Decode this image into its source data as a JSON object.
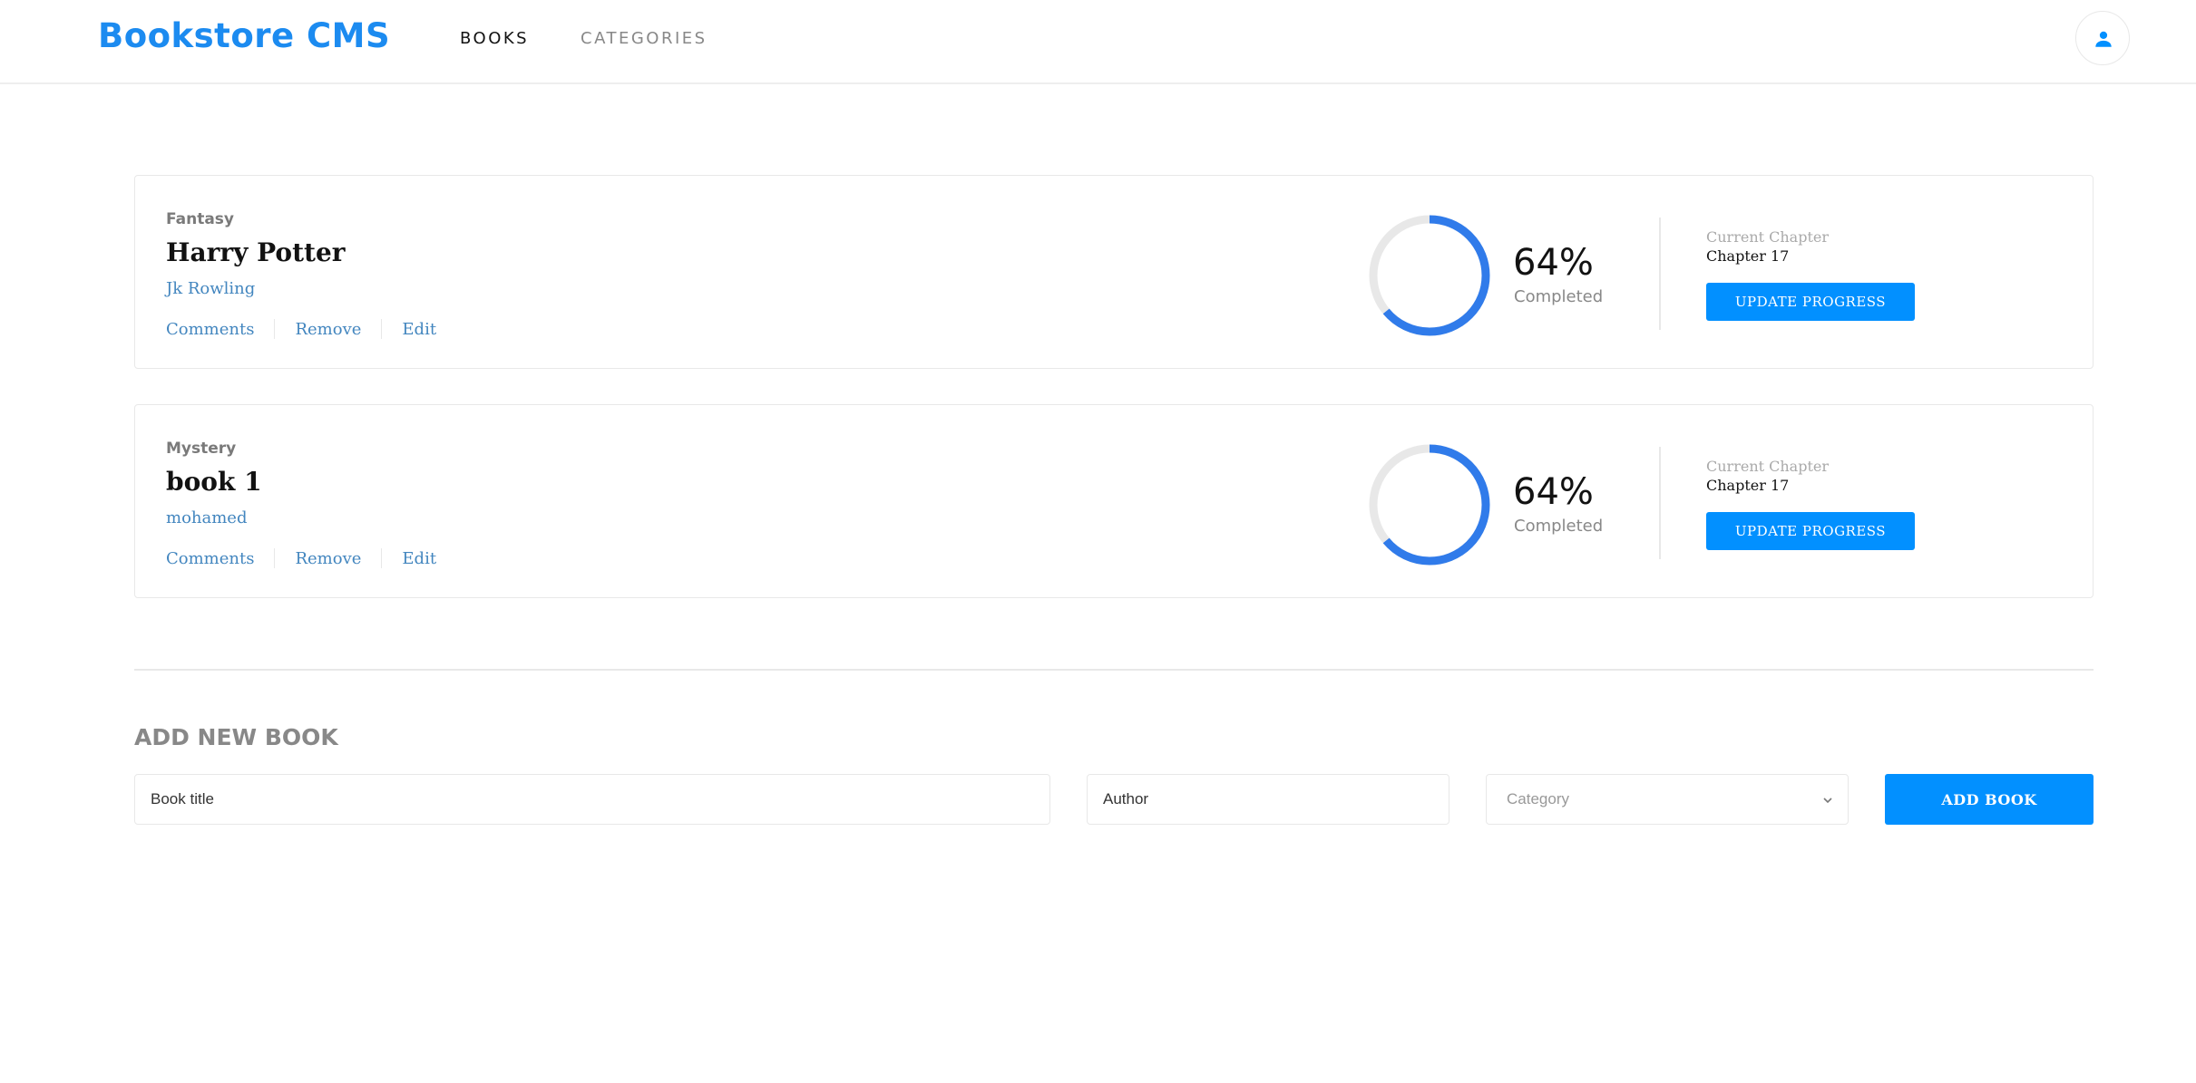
{
  "header": {
    "logo": "Bookstore CMS",
    "nav": [
      {
        "label": "BOOKS",
        "active": true
      },
      {
        "label": "CATEGORIES",
        "active": false
      }
    ],
    "user_icon": "user-icon"
  },
  "books": [
    {
      "genre": "Fantasy",
      "title": "Harry Potter",
      "author": "Jk Rowling",
      "actions": [
        "Comments",
        "Remove",
        "Edit"
      ],
      "progress_percent": 64,
      "percent_label": "64%",
      "completed_label": "Completed",
      "chapter_label": "Current Chapter",
      "chapter_value": "Chapter 17",
      "update_button": "UPDATE PROGRESS"
    },
    {
      "genre": "Mystery",
      "title": "book 1",
      "author": "mohamed",
      "actions": [
        "Comments",
        "Remove",
        "Edit"
      ],
      "progress_percent": 64,
      "percent_label": "64%",
      "completed_label": "Completed",
      "chapter_label": "Current Chapter",
      "chapter_value": "Chapter 17",
      "update_button": "UPDATE PROGRESS"
    }
  ],
  "add_form": {
    "title": "ADD NEW BOOK",
    "title_placeholder": "Book title",
    "author_placeholder": "Author",
    "category_placeholder": "Category",
    "submit_label": "ADD BOOK"
  },
  "colors": {
    "accent": "#0290ff",
    "logo": "#1c8bf0",
    "progress": "#307bea",
    "progress_track": "#e8e8e8",
    "link": "#4386bf"
  }
}
